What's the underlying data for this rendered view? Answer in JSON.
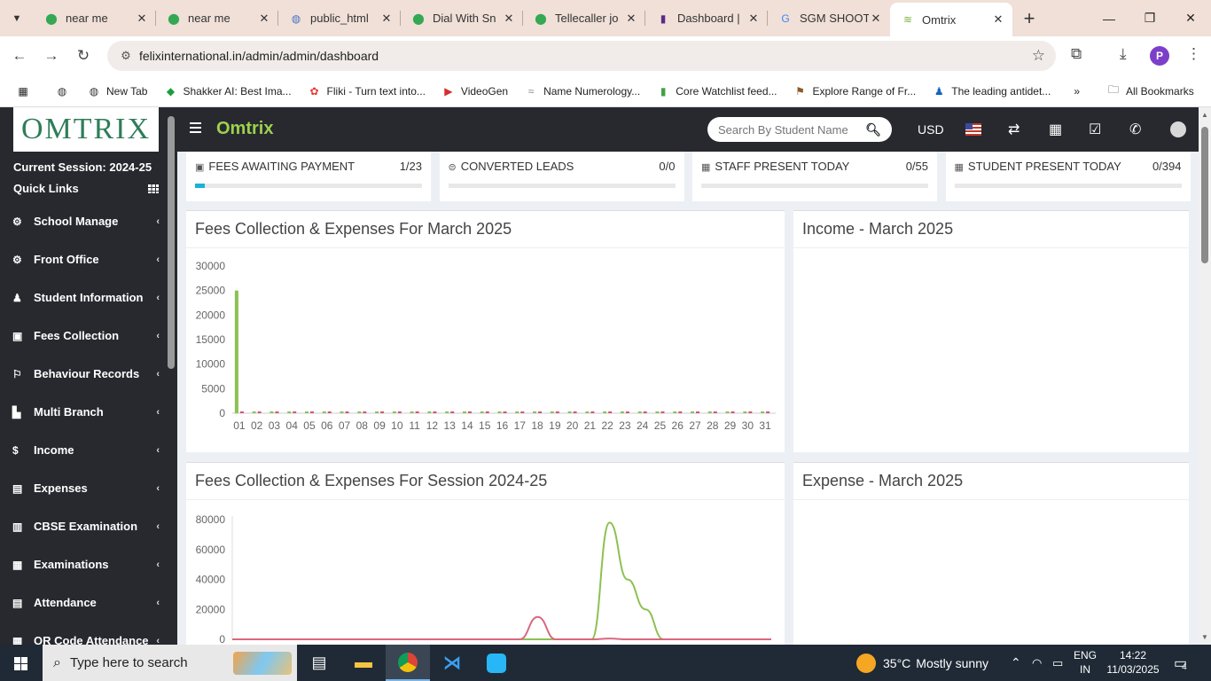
{
  "browser": {
    "tabs": [
      {
        "title": "near me",
        "icon": "maps-pin-icon",
        "active": false
      },
      {
        "title": "near me",
        "icon": "maps-pin-icon",
        "active": false
      },
      {
        "title": "public_html",
        "icon": "globe-icon",
        "active": false
      },
      {
        "title": "Dial With Sn",
        "icon": "maps-pin-icon",
        "active": false
      },
      {
        "title": "Tellecaller jo",
        "icon": "maps-pin-icon",
        "active": false
      },
      {
        "title": "Dashboard |",
        "icon": "dashboard-icon",
        "active": false
      },
      {
        "title": "SGM SHOOT",
        "icon": "google-icon",
        "active": false
      },
      {
        "title": "Omtrix",
        "icon": "omtrix-icon",
        "active": true
      }
    ],
    "url": "felixinternational.in/admin/admin/dashboard",
    "profile_initial": "P",
    "bookmarks": [
      {
        "label": "",
        "icon": "globe-icon"
      },
      {
        "label": "New Tab",
        "icon": "globe-icon"
      },
      {
        "label": "Shakker AI: Best Ima...",
        "icon": "shakker-icon"
      },
      {
        "label": "Fliki - Turn text into...",
        "icon": "fliki-icon"
      },
      {
        "label": "VideoGen",
        "icon": "videogen-icon"
      },
      {
        "label": "Name Numerology...",
        "icon": "numerology-icon"
      },
      {
        "label": "Core Watchlist feed...",
        "icon": "chart-icon"
      },
      {
        "label": "Explore Range of Fr...",
        "icon": "explore-icon"
      },
      {
        "label": "The leading antidet...",
        "icon": "person-icon"
      }
    ],
    "all_bookmarks": "All Bookmarks"
  },
  "app": {
    "logo_text": "OMTRIX",
    "brand": "Omtrix",
    "session": "Current Session: 2024-25",
    "quick_links": "Quick Links",
    "search_placeholder": "Search By Student Name",
    "currency": "USD",
    "menu": [
      {
        "label": "School Manage",
        "icon": "school-icon"
      },
      {
        "label": "Front Office",
        "icon": "front-office-icon"
      },
      {
        "label": "Student Information",
        "icon": "student-icon"
      },
      {
        "label": "Fees Collection",
        "icon": "fees-icon"
      },
      {
        "label": "Behaviour Records",
        "icon": "behaviour-icon"
      },
      {
        "label": "Multi Branch",
        "icon": "branch-icon"
      },
      {
        "label": "Income",
        "icon": "dollar-icon"
      },
      {
        "label": "Expenses",
        "icon": "expenses-icon"
      },
      {
        "label": "CBSE Examination",
        "icon": "cbse-icon"
      },
      {
        "label": "Examinations",
        "icon": "exam-icon"
      },
      {
        "label": "Attendance",
        "icon": "attendance-icon"
      },
      {
        "label": "QR Code Attendance",
        "icon": "qr-icon"
      }
    ]
  },
  "stats": [
    {
      "label": "FEES AWAITING PAYMENT",
      "value": "1/23",
      "progress": 0.0435
    },
    {
      "label": "CONVERTED LEADS",
      "value": "0/0",
      "progress": 0
    },
    {
      "label": "STAFF PRESENT TODAY",
      "value": "0/55",
      "progress": 0
    },
    {
      "label": "STUDENT PRESENT TODAY",
      "value": "0/394",
      "progress": 0
    }
  ],
  "panels": {
    "monthly_title": "Fees Collection & Expenses For March 2025",
    "income_title": "Income - March 2025",
    "session_title": "Fees Collection & Expenses For Session 2024-25",
    "expense_title": "Expense - March 2025"
  },
  "chart_data": [
    {
      "type": "bar",
      "categories": [
        "01",
        "02",
        "03",
        "04",
        "05",
        "06",
        "07",
        "08",
        "09",
        "10",
        "11",
        "12",
        "13",
        "14",
        "15",
        "16",
        "17",
        "18",
        "19",
        "20",
        "21",
        "22",
        "23",
        "24",
        "25",
        "26",
        "27",
        "28",
        "29",
        "30",
        "31"
      ],
      "series": [
        {
          "color": "#8cc152",
          "values": [
            25000,
            0,
            0,
            0,
            0,
            0,
            0,
            0,
            0,
            0,
            0,
            0,
            0,
            0,
            0,
            0,
            0,
            0,
            0,
            0,
            0,
            0,
            0,
            0,
            0,
            0,
            0,
            0,
            0,
            0,
            0
          ]
        },
        {
          "color": "#d9536f",
          "values": [
            0,
            0,
            0,
            0,
            0,
            0,
            0,
            0,
            0,
            0,
            0,
            0,
            0,
            0,
            0,
            0,
            0,
            0,
            0,
            0,
            0,
            0,
            0,
            0,
            0,
            0,
            0,
            0,
            0,
            0,
            0
          ]
        }
      ],
      "yticks": [
        0,
        5000,
        10000,
        15000,
        20000,
        25000,
        30000
      ],
      "ylim": [
        0,
        30000
      ]
    },
    {
      "type": "line",
      "series": [
        {
          "color": "#8cc152",
          "values": [
            0,
            0,
            0,
            0,
            0,
            0,
            0,
            0,
            0,
            0,
            0,
            0,
            0,
            0,
            0,
            0,
            0,
            0,
            0,
            0,
            0,
            78000,
            40000,
            20000,
            0,
            0,
            0,
            0,
            0,
            0,
            0
          ]
        },
        {
          "color": "#d9687f",
          "values": [
            0,
            0,
            0,
            0,
            0,
            0,
            0,
            0,
            0,
            0,
            0,
            0,
            0,
            0,
            0,
            0,
            0,
            15000,
            0,
            0,
            0,
            500,
            0,
            0,
            0,
            0,
            0,
            0,
            0,
            0,
            0
          ]
        }
      ],
      "yticks": [
        0,
        20000,
        40000,
        60000,
        80000
      ],
      "ylim": [
        0,
        80000
      ]
    }
  ],
  "taskbar": {
    "search_text": "Type here to search",
    "temperature": "35°C",
    "weather": "Mostly sunny",
    "lang1": "ENG",
    "lang2": "IN",
    "time": "14:22",
    "date": "11/03/2025",
    "notifications": "4"
  }
}
